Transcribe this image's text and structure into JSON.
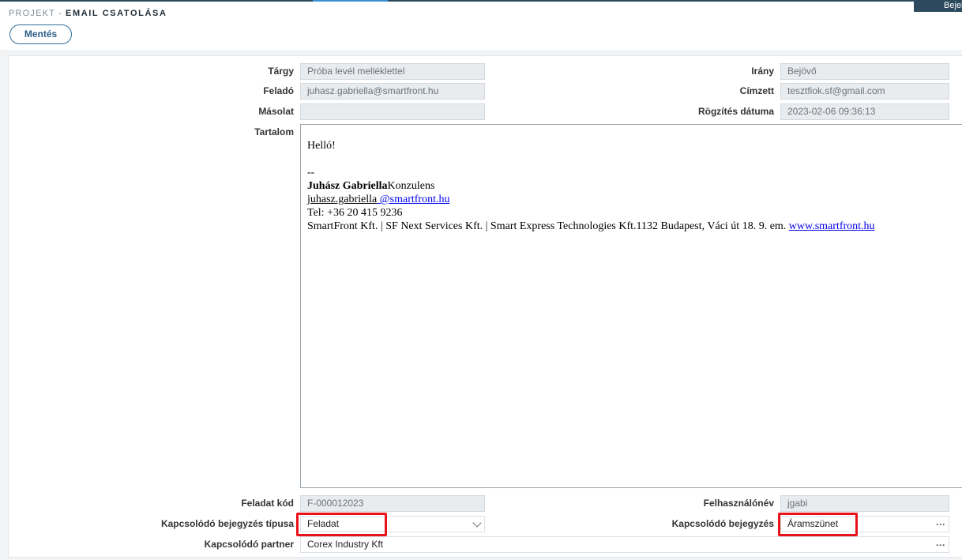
{
  "header": {
    "breadcrumb_parent": "PROJEKT",
    "breadcrumb_sep": "-",
    "breadcrumb_current": "EMAIL CSATOLÁSA",
    "user_tab": "Bejelentkezés"
  },
  "toolbar": {
    "save_label": "Mentés"
  },
  "form": {
    "subject": {
      "label": "Tárgy",
      "value": "Próba levél melléklettel"
    },
    "sender": {
      "label": "Feladó",
      "value": "juhasz.gabriella@smartfront.hu"
    },
    "cc": {
      "label": "Másolat",
      "value": ""
    },
    "direction": {
      "label": "Irány",
      "value": "Bejövő"
    },
    "recipient": {
      "label": "Címzett",
      "value": "tesztfiok.sf@gmail.com"
    },
    "recorded_date": {
      "label": "Rögzítés dátuma",
      "value": "2023-02-06 09:36:13"
    },
    "content": {
      "label": "Tartalom",
      "greeting": "Helló!",
      "sig_sep": "--",
      "sig_name": "Juhász Gabriella",
      "sig_title": "Konzulens",
      "sig_email_user": "juhasz.gabriella",
      "sig_email_domain": " @smartfront.hu",
      "sig_phone": "Tel: +36 20 415 9236",
      "sig_company": "SmartFront Kft. | SF Next Services Kft. | Smart Express Technologies Kft.1132 Budapest, Váci út 18. 9. em. ",
      "sig_web": "www.smartfront.hu"
    },
    "task_code": {
      "label": "Feladat kód",
      "value": "F-000012023"
    },
    "username": {
      "label": "Felhasználónév",
      "value": "jgabi"
    },
    "related_type": {
      "label": "Kapcsolódó bejegyzés típusa",
      "value": "Feladat"
    },
    "related_entry": {
      "label": "Kapcsolódó bejegyzés",
      "value": "Áramszünet"
    },
    "related_partner": {
      "label": "Kapcsolódó partner",
      "value": "Corex Industry Kft"
    }
  },
  "icons": {
    "dropdown": "chevron-down-icon",
    "lookup": "ellipsis-icon"
  },
  "colors": {
    "accent": "#2b4a5e",
    "highlight": "#e8121b",
    "link": "#0000ee"
  }
}
